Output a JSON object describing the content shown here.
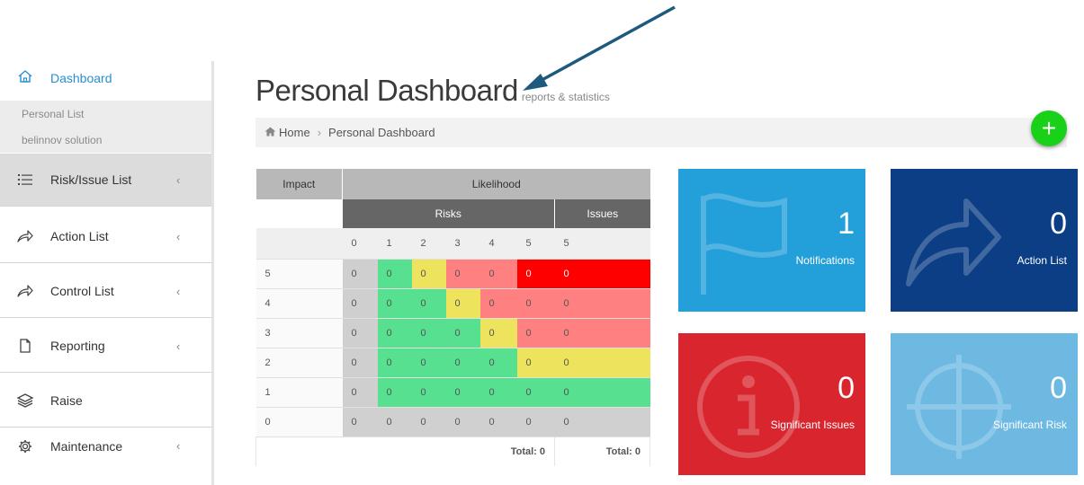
{
  "sidebar": {
    "dashboard_label": "Dashboard",
    "sub_items": [
      "Personal List",
      "belinnov solution"
    ],
    "items": [
      {
        "label": "Risk/Issue List",
        "icon": "list-icon",
        "has_submenu": true
      },
      {
        "label": "Action List",
        "icon": "share-arrow-icon",
        "has_submenu": true
      },
      {
        "label": "Control List",
        "icon": "share-arrow-icon",
        "has_submenu": true
      },
      {
        "label": "Reporting",
        "icon": "document-icon",
        "has_submenu": true
      },
      {
        "label": "Raise",
        "icon": "layers-icon",
        "has_submenu": false
      },
      {
        "label": "Maintenance",
        "icon": "gear-icon",
        "has_submenu": true
      }
    ],
    "chevron": "‹"
  },
  "header": {
    "title": "Personal Dashboard",
    "subtitle": "reports & statistics"
  },
  "breadcrumb": {
    "home": "Home",
    "separator": "›",
    "current": "Personal Dashboard"
  },
  "add_button": "+",
  "matrix": {
    "impact_header": "Impact",
    "likelihood_header": "Likelihood",
    "risks_header": "Risks",
    "issues_header": "Issues",
    "likelihood_values": [
      "0",
      "1",
      "2",
      "3",
      "4",
      "5",
      "5"
    ],
    "rows": [
      {
        "impact": "5",
        "cells": [
          "0",
          "0",
          "0",
          "0",
          "0",
          "0",
          "0"
        ]
      },
      {
        "impact": "4",
        "cells": [
          "0",
          "0",
          "0",
          "0",
          "0",
          "0",
          "0"
        ]
      },
      {
        "impact": "3",
        "cells": [
          "0",
          "0",
          "0",
          "0",
          "0",
          "0",
          "0"
        ]
      },
      {
        "impact": "2",
        "cells": [
          "0",
          "0",
          "0",
          "0",
          "0",
          "0",
          "0"
        ]
      },
      {
        "impact": "1",
        "cells": [
          "0",
          "0",
          "0",
          "0",
          "0",
          "0",
          "0"
        ]
      },
      {
        "impact": "0",
        "cells": [
          "0",
          "0",
          "0",
          "0",
          "0",
          "0",
          "0"
        ]
      }
    ],
    "risks_total": "Total: 0",
    "issues_total": "Total: 0"
  },
  "tiles": [
    {
      "value": "1",
      "label": "Notifications",
      "color": "#239fd9",
      "icon": "flag-icon"
    },
    {
      "value": "0",
      "label": "Action List",
      "color": "#0c3e86",
      "icon": "share-arrow-icon"
    },
    {
      "value": "0",
      "label": "Significant Issues",
      "color": "#d9262e",
      "icon": "info-icon"
    },
    {
      "value": "0",
      "label": "Significant Risk",
      "color": "#6db9e2",
      "icon": "crosshair-icon"
    }
  ],
  "colors": {
    "accent": "#2a8fd0",
    "add_button": "#19d119",
    "annotation_arrow": "#1d5a7d",
    "matrix_green": "#56e08f",
    "matrix_yellow": "#ede35c",
    "matrix_pink": "#ff8080",
    "matrix_red": "#ff0000"
  }
}
